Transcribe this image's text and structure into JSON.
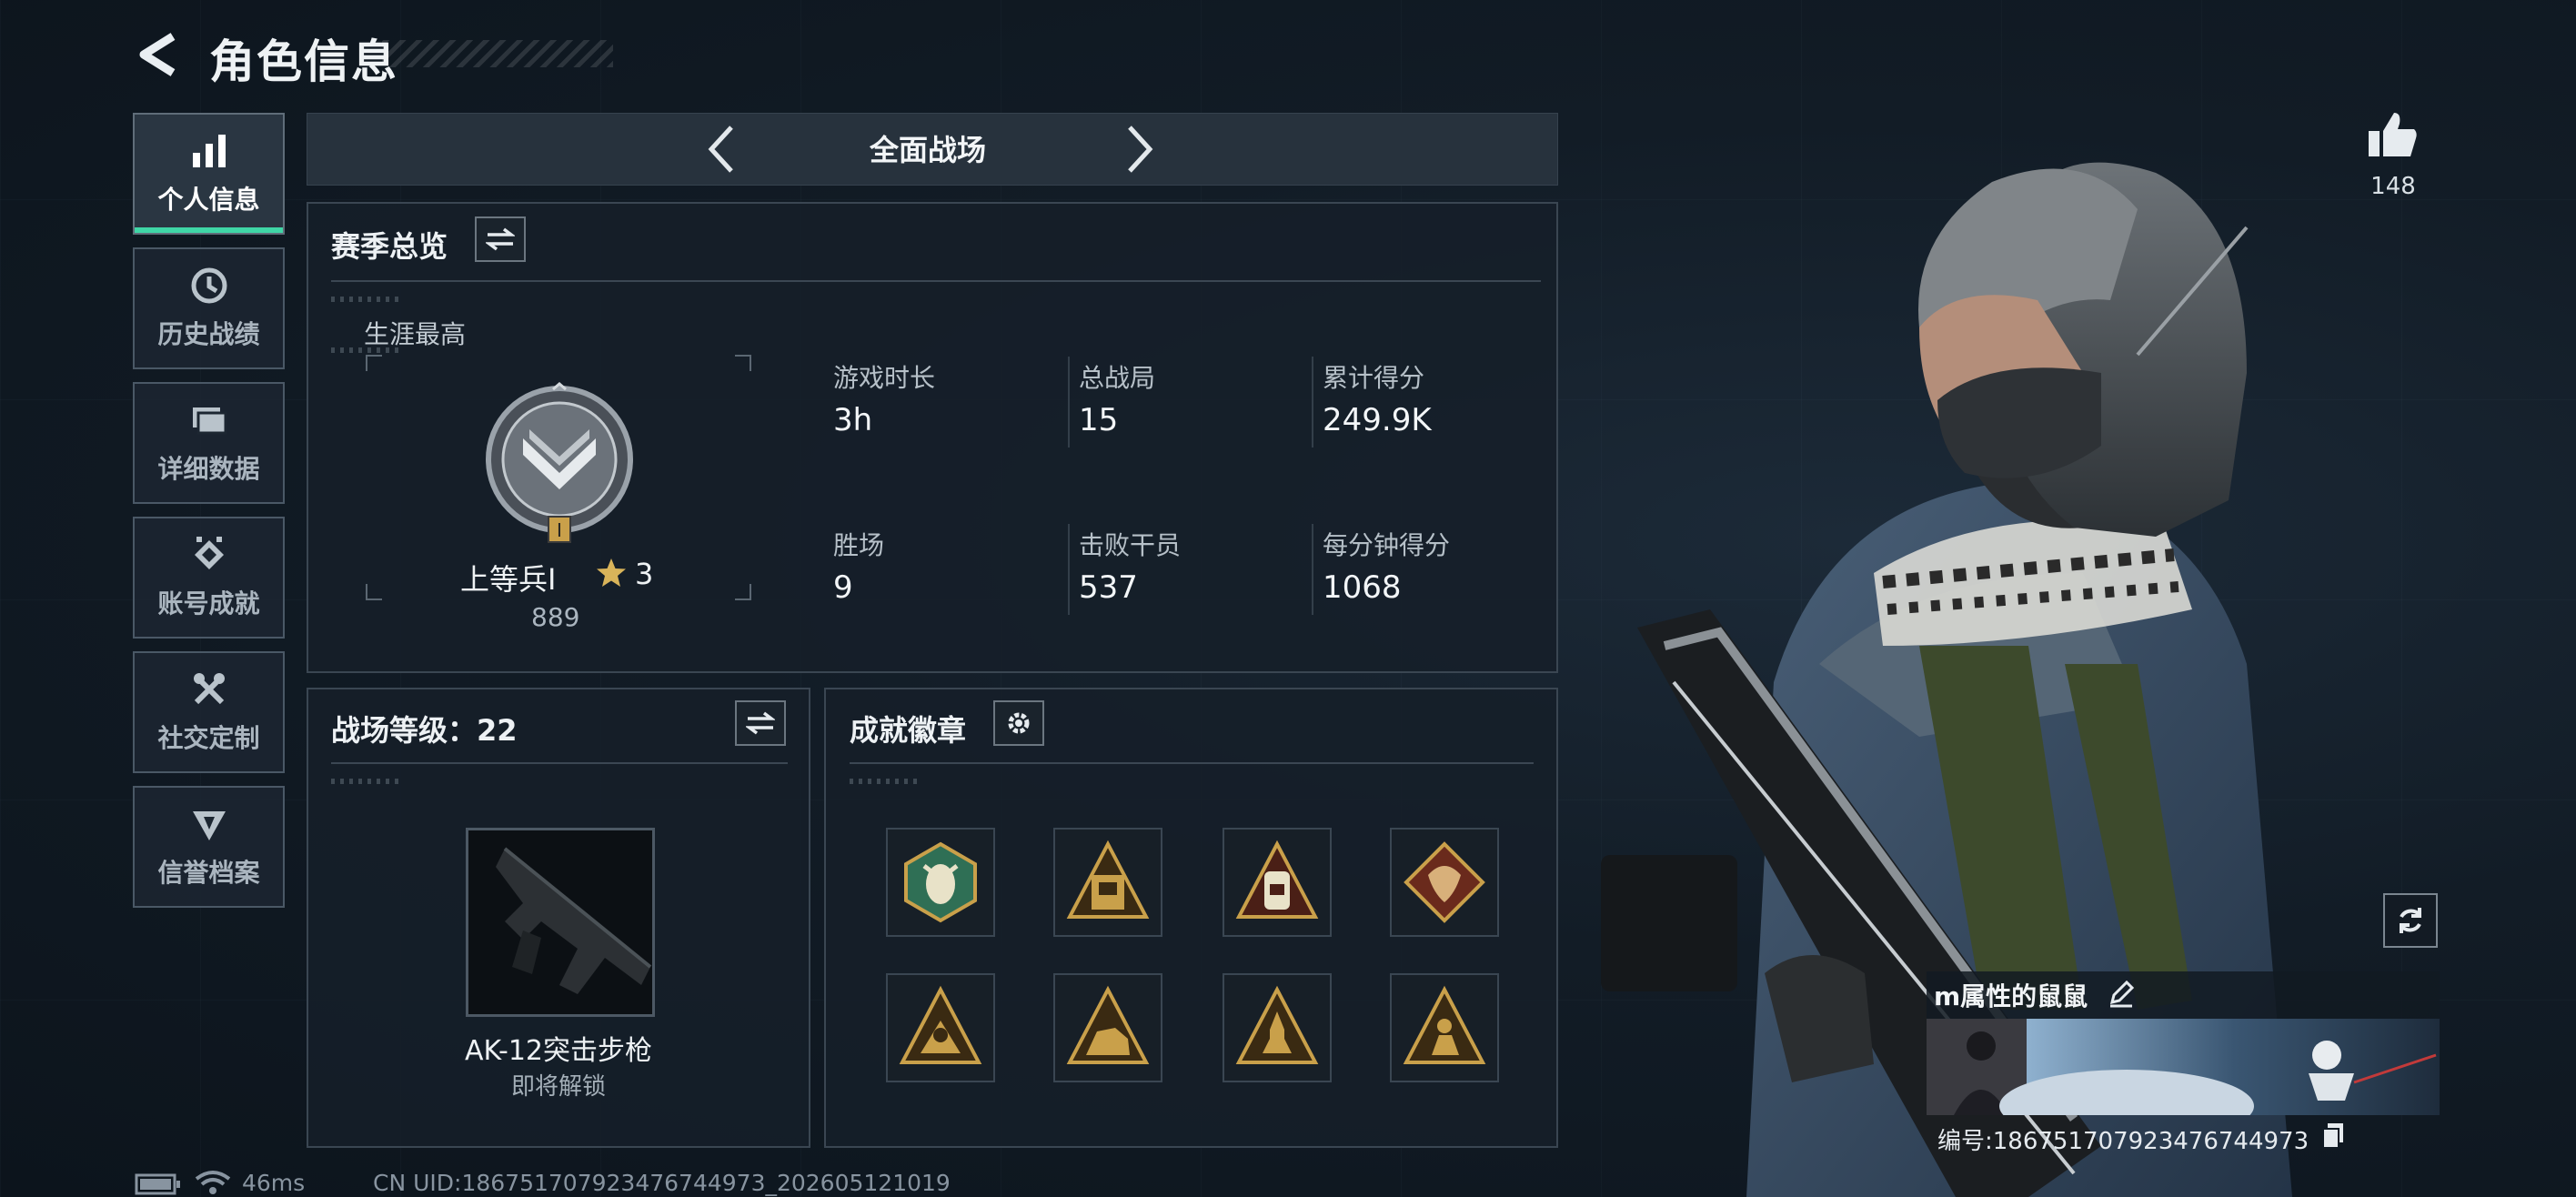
{
  "header": {
    "title": "角色信息"
  },
  "sidebar": {
    "items": [
      {
        "label": "个人信息",
        "icon": "bar-chart-icon",
        "active": true
      },
      {
        "label": "历史战绩",
        "icon": "history-icon",
        "active": false
      },
      {
        "label": "详细数据",
        "icon": "folder-icon",
        "active": false
      },
      {
        "label": "账号成就",
        "icon": "medal-icon",
        "active": false
      },
      {
        "label": "社交定制",
        "icon": "tools-icon",
        "active": false
      },
      {
        "label": "信誉档案",
        "icon": "shield-icon",
        "active": false
      }
    ]
  },
  "mode_tab": {
    "label": "全面战场"
  },
  "season": {
    "title": "赛季总览",
    "career_best_label": "生涯最高",
    "rank_name": "上等兵Ⅰ",
    "rank_stars": "3",
    "rank_points": "889",
    "rank_badge_numeral": "I",
    "stats": [
      {
        "label": "游戏时长",
        "value": "3h"
      },
      {
        "label": "总战局",
        "value": "15"
      },
      {
        "label": "累计得分",
        "value": "249.9K"
      },
      {
        "label": "胜场",
        "value": "9"
      },
      {
        "label": "击败干员",
        "value": "537"
      },
      {
        "label": "每分钟得分",
        "value": "1068"
      }
    ]
  },
  "battlefield": {
    "title": "战场等级：22",
    "weapon_name": "AK-12突击步枪",
    "weapon_status": "即将解锁"
  },
  "achievements": {
    "title": "成就徽章",
    "badges": [
      {
        "icon": "hornet-badge-icon",
        "color": "#2f6f55"
      },
      {
        "icon": "card-badge-icon",
        "color": "#b8862a"
      },
      {
        "icon": "dogtag-badge-icon",
        "color": "#b8862a"
      },
      {
        "icon": "dragon-badge-icon",
        "color": "#8a3a26"
      },
      {
        "icon": "runner-badge-icon",
        "color": "#b8862a"
      },
      {
        "icon": "dog-badge-icon",
        "color": "#b8862a"
      },
      {
        "icon": "rocket-badge-icon",
        "color": "#b8862a"
      },
      {
        "icon": "shooter-badge-icon",
        "color": "#b8862a"
      }
    ]
  },
  "profile": {
    "likes": "148",
    "nickname": "m属性的鼠鼠",
    "id_line": "编号:1867517079234767449​73"
  },
  "footer": {
    "ping": "46ms",
    "uid": "CN UID:1867517079234767449​73_202605121019"
  },
  "colors": {
    "accent": "#3fd6a6",
    "gold": "#c9a04a",
    "panel": "#161f29"
  }
}
